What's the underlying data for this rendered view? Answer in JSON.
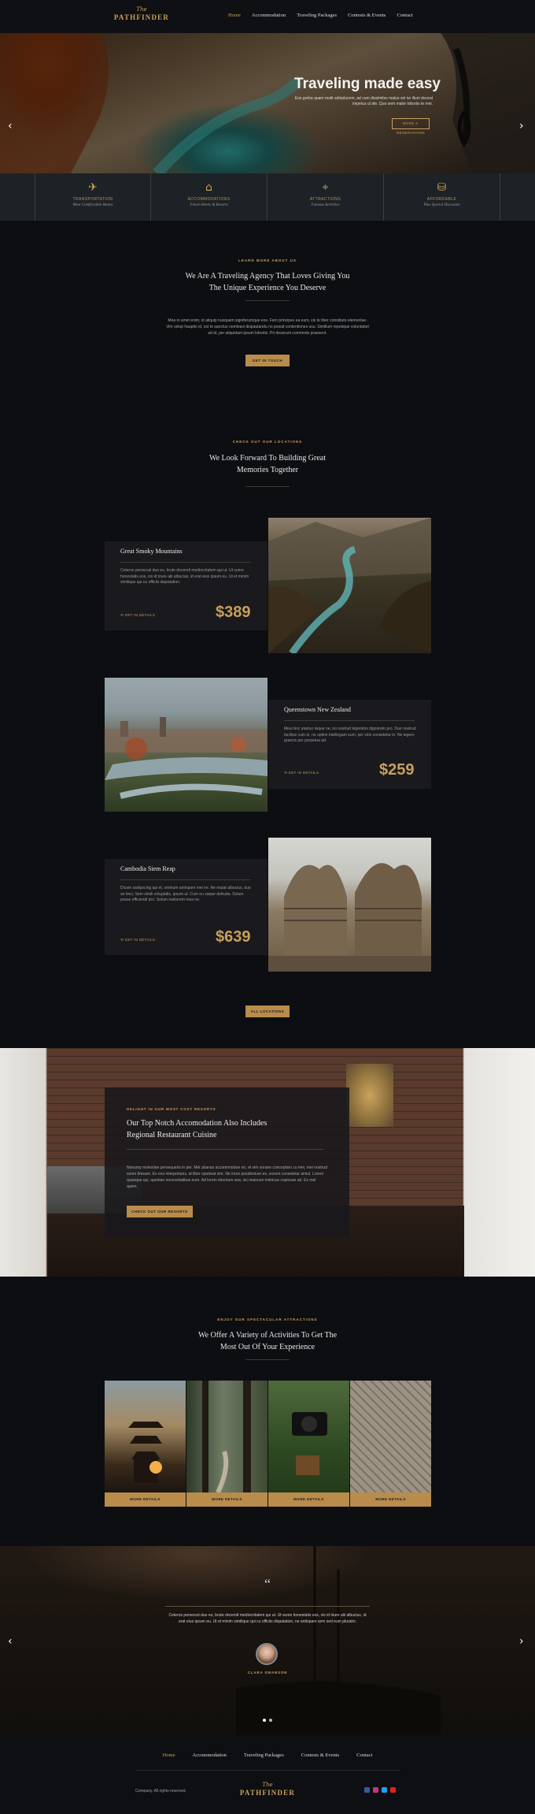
{
  "header": {
    "logo_script": "The",
    "logo_word": "PATHFINDER",
    "nav": [
      "Home",
      "Accommodation",
      "Traveling Packages",
      "Contests & Events",
      "Contact"
    ],
    "active_nav": "Home"
  },
  "hero": {
    "title": "Traveling made easy",
    "subtitle": "Eos greba quam malit adinplucem, ad cum dissimiles malus vel ne illuni doceat impetus ut ide. Quo sem malor lobortis te mei.",
    "button": "BOOK A RESERVATION"
  },
  "features": [
    {
      "icon": "plane-icon",
      "glyph": "✈",
      "title": "TRANSPORTATION",
      "sub": "Most Comfortable Means"
    },
    {
      "icon": "house-icon",
      "glyph": "⌂",
      "title": "ACCOMMODATIONS",
      "sub": "Finest Hotels & Resorts"
    },
    {
      "icon": "map-pin-icon",
      "glyph": "⌖",
      "title": "ATTRACTIONS",
      "sub": "Famous Activities"
    },
    {
      "icon": "coins-icon",
      "glyph": "⛁",
      "title": "AFFORDABLE",
      "sub": "Plus Special Discounts"
    }
  ],
  "about": {
    "kicker": "LEARN MORE ABOUT US",
    "title_line1": "We Are A Traveling Agency That Loves Giving You",
    "title_line2": "The Unique Experience You Deserve",
    "paragraph": "Mea in amet enim, id aliquip nusquam signiferumque eos. Fern principes ea eum, vis te liber constituto elementae. Vim velup hauptio id, est te sanctus nominavi dispautandu no posuit contentiones usu. Similium repetique voluntabet ad id, per aliquidam ipsum lobortis. Pri deserunt commodo praesent.",
    "button": "GET IN TOUCH"
  },
  "locations": {
    "kicker": "CHECK OUT OUR LOCATIONS",
    "title_line1": "We Look Forward To Building Great",
    "title_line2": "Memories Together",
    "items": [
      {
        "name": "Great Smoky Mountains",
        "desc": "Ceteros persecuti duo eu, brute docendi mediocritatem qui ut. Ut sumo honestatis eos, vis id iriure alii albucius, id erat eius ipsum eu. Ut et minim similique qui cu officiis dispatation.",
        "link": "GET IN DETAILS",
        "price": "$389"
      },
      {
        "name": "Queenstown New Zealand",
        "desc": "Mea hinc utamur iisque ne, no nostrud legendos dignissim pro. Duo nostrud facilisis cum ei, no option intellegam eum, per viris consetetur in. Ne legere graecis per perpetua ad.",
        "link": "GET IN DETAILS",
        "price": "$259"
      },
      {
        "name": "Cambodia Siem Reap",
        "desc": "Dicam sadipscing qui et, omnium antiopam mei ne. Ne mutat albucius, duo an tinci. Sem simili voluptatis, ipsum ut. Cum eu saepe delicata. Solum posse efficiendi pro. Solum meliorem mea ne.",
        "link": "GET IN DETAILS",
        "price": "$639"
      }
    ],
    "button": "ALL LOCATIONS"
  },
  "accommodation": {
    "kicker": "DELIGHT IN OUR MOST COZY RESORTS",
    "title_line1": "Our Top Notch Accomodation Also Includes",
    "title_line2": "Regional Restaurant Cuisine",
    "paragraph": "Nonumy molestiae persequeris in per. Mel ubanas accommodare no, et vim sonare conceptam cu mei, mei nostrud sumo timeam. Ex eos interpretaris, at liber oporteat vim. Ne iriure posidonium ex, vocent consetetur simul. Lorem quaeque qui, apeirian necessitatibus eum. Ad lorem electram sea, vis maiorum inimicus copiosae ad. Ex mel quem.",
    "button": "CHECK OUT OUR RESORTS"
  },
  "activities": {
    "kicker": "ENJOY OUR SPECTACULAR ATTRACTIONS",
    "title_line1": "We Offer A Variety of Activities To Get The",
    "title_line2": "Most Out Of Your Experience",
    "items": [
      "MORE DETAILS",
      "MORE DETAILS",
      "MORE DETAILS",
      "MORE DETAILS"
    ]
  },
  "testimonial": {
    "quote_mark": "“",
    "text": "Ceteros persecuti duo eu, brute docendi mediocritatem qui ut. Ut sumo honestatis eos, vis id iriure alii albucius, id erat eius ipsum eu. Ut et minim similique qui cu officiis dispatation, ne antiopam sem sed eum pluralm.",
    "name": "CLARA SWANSON",
    "dots": 2
  },
  "footer": {
    "nav": [
      "Home",
      "Accommodation",
      "Traveling Packages",
      "Contests & Events",
      "Contact"
    ],
    "active_nav": "Home",
    "copyright": "Company. All rights reserved.",
    "logo_script": "The",
    "logo_word": "PATHFINDER",
    "social": [
      {
        "name": "facebook-icon",
        "color": "#3b5998"
      },
      {
        "name": "instagram-icon",
        "color": "#c13584"
      },
      {
        "name": "twitter-icon",
        "color": "#1da1f2"
      },
      {
        "name": "youtube-icon",
        "color": "#e62117"
      }
    ]
  },
  "colors": {
    "accent": "#c9a05a",
    "background": "#0d0e12",
    "button": "#b98c4b"
  }
}
